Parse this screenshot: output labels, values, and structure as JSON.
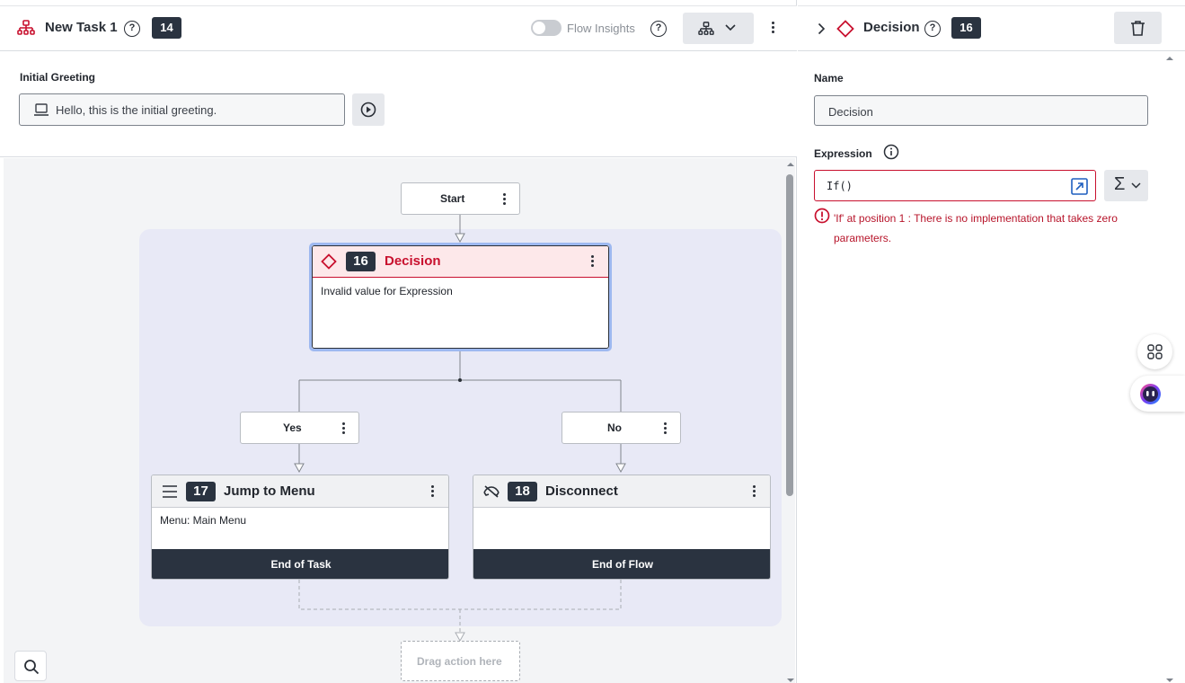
{
  "header": {
    "title": "New Task 1",
    "task_badge": "14",
    "help_icon": "question-circle-icon",
    "flow_insights_label": "Flow Insights",
    "flow_insights_enabled": false
  },
  "greeting": {
    "label": "Initial Greeting",
    "value": "Hello, this is the initial greeting."
  },
  "flow": {
    "start_label": "Start",
    "decision": {
      "number": "16",
      "title": "Decision",
      "message": "Invalid value for Expression"
    },
    "branches": [
      {
        "label": "Yes"
      },
      {
        "label": "No"
      }
    ],
    "jump_card": {
      "number": "17",
      "title": "Jump to Menu",
      "body": "Menu: Main Menu",
      "footer": "End of Task"
    },
    "disconnect_card": {
      "number": "18",
      "title": "Disconnect",
      "body": "",
      "footer": "End of Flow"
    },
    "drop_zone_label": "Drag action here"
  },
  "panel": {
    "title": "Decision",
    "badge": "16",
    "name_label": "Name",
    "name_value": "Decision",
    "expression_label": "Expression",
    "expression_value": "If()",
    "error_message": "'If' at position 1 : There is no implementation that takes zero parameters."
  },
  "colors": {
    "error_red": "#c8102e",
    "dark_badge": "#2a3340",
    "canvas_group": "#e8e9f6",
    "selection_blue": "#9db8f0"
  }
}
